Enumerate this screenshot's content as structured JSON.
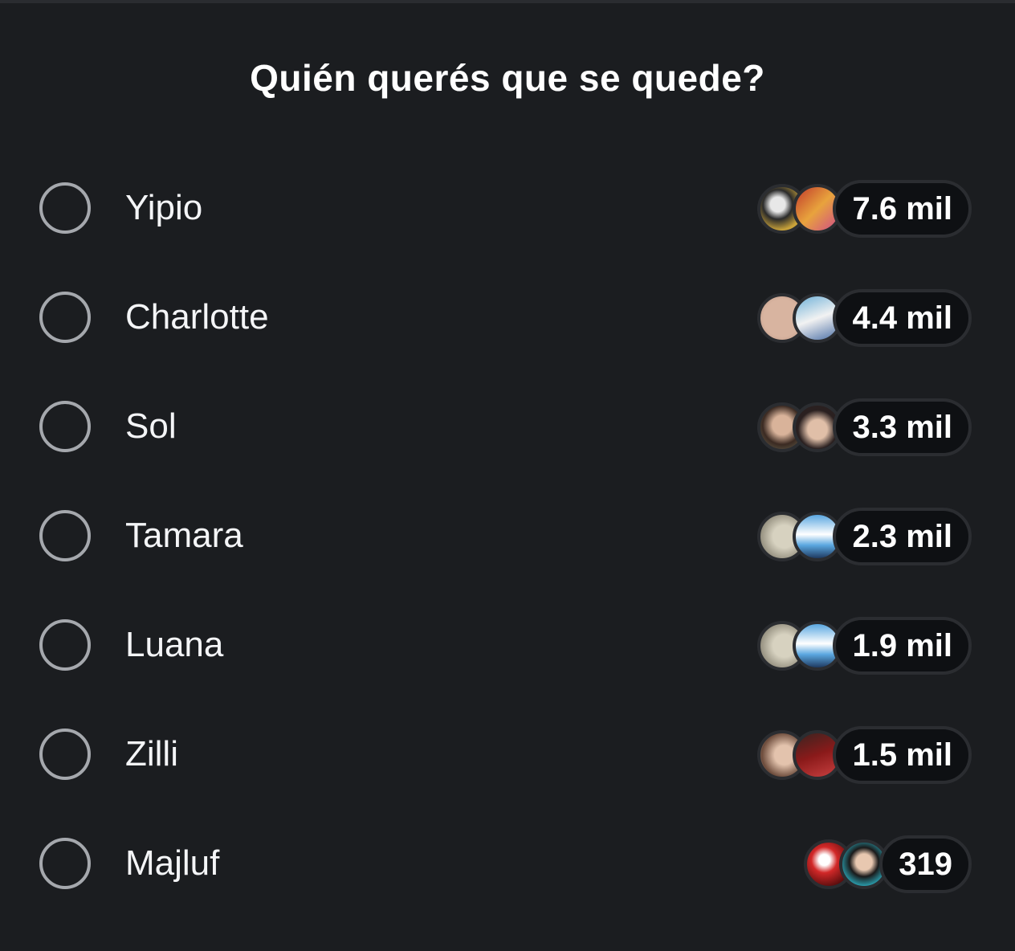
{
  "poll": {
    "title": "Quién querés que se quede?",
    "options": [
      {
        "label": "Yipio",
        "count": "7.6 mil",
        "avatars": [
          {
            "bg": "radial-gradient(circle at 40% 40%, #e8e8e8 0 20%, #2a2a2a 40%, #c8a23a 70%)"
          },
          {
            "bg": "linear-gradient(135deg, #c0392b, #e8a33d 50%, #d04a8a)"
          }
        ]
      },
      {
        "label": "Charlotte",
        "count": "4.4 mil",
        "avatars": [
          {
            "bg": "radial-gradient(circle, #d8b4a0 0 60%, #b89280)"
          },
          {
            "bg": "linear-gradient(160deg, #6fb1d8, #f2f2f2 50%, #4a6fa5)"
          }
        ]
      },
      {
        "label": "Sol",
        "count": "3.3 mil",
        "avatars": [
          {
            "bg": "radial-gradient(circle at 50% 45%, #d9b39a 0 30%, #3b2a22 60%, #6b6b55)"
          },
          {
            "bg": "radial-gradient(circle at 50% 55%, #e0bfa8 0 30%, #2a2020 60%)"
          }
        ]
      },
      {
        "label": "Tamara",
        "count": "2.3 mil",
        "avatars": [
          {
            "bg": "radial-gradient(circle at 55% 50%, #d7d2c0 0 35%, #8a8575 80%)"
          },
          {
            "bg": "linear-gradient(180deg, #5aa7e0, #ffffff 45%, #5aa7e0 70%, #1f3a60)"
          }
        ]
      },
      {
        "label": "Luana",
        "count": "1.9 mil",
        "avatars": [
          {
            "bg": "radial-gradient(circle at 55% 50%, #d7d2c0 0 35%, #8a8575 80%)"
          },
          {
            "bg": "linear-gradient(180deg, #5aa7e0, #ffffff 45%, #5aa7e0 70%, #1f3a60)"
          }
        ]
      },
      {
        "label": "Zilli",
        "count": "1.5 mil",
        "avatars": [
          {
            "bg": "radial-gradient(circle at 55% 50%, #e3c3ad 0 30%, #6b4a3a 70%, #cfcfcf)"
          },
          {
            "bg": "linear-gradient(160deg, #3a2420, #8b1a1a 50%, #c84040)"
          }
        ]
      },
      {
        "label": "Majluf",
        "count": "319",
        "avatars": [
          {
            "bg": "radial-gradient(circle at 40% 40%, #ffffff 0 15%, #d22828 35%, #4a0a0a 80%)"
          },
          {
            "bg": "radial-gradient(circle at 50% 45%, #e8c8b0 0 25%, #1a1a1a 45%, #2aa0b0 75%)"
          }
        ]
      }
    ]
  }
}
